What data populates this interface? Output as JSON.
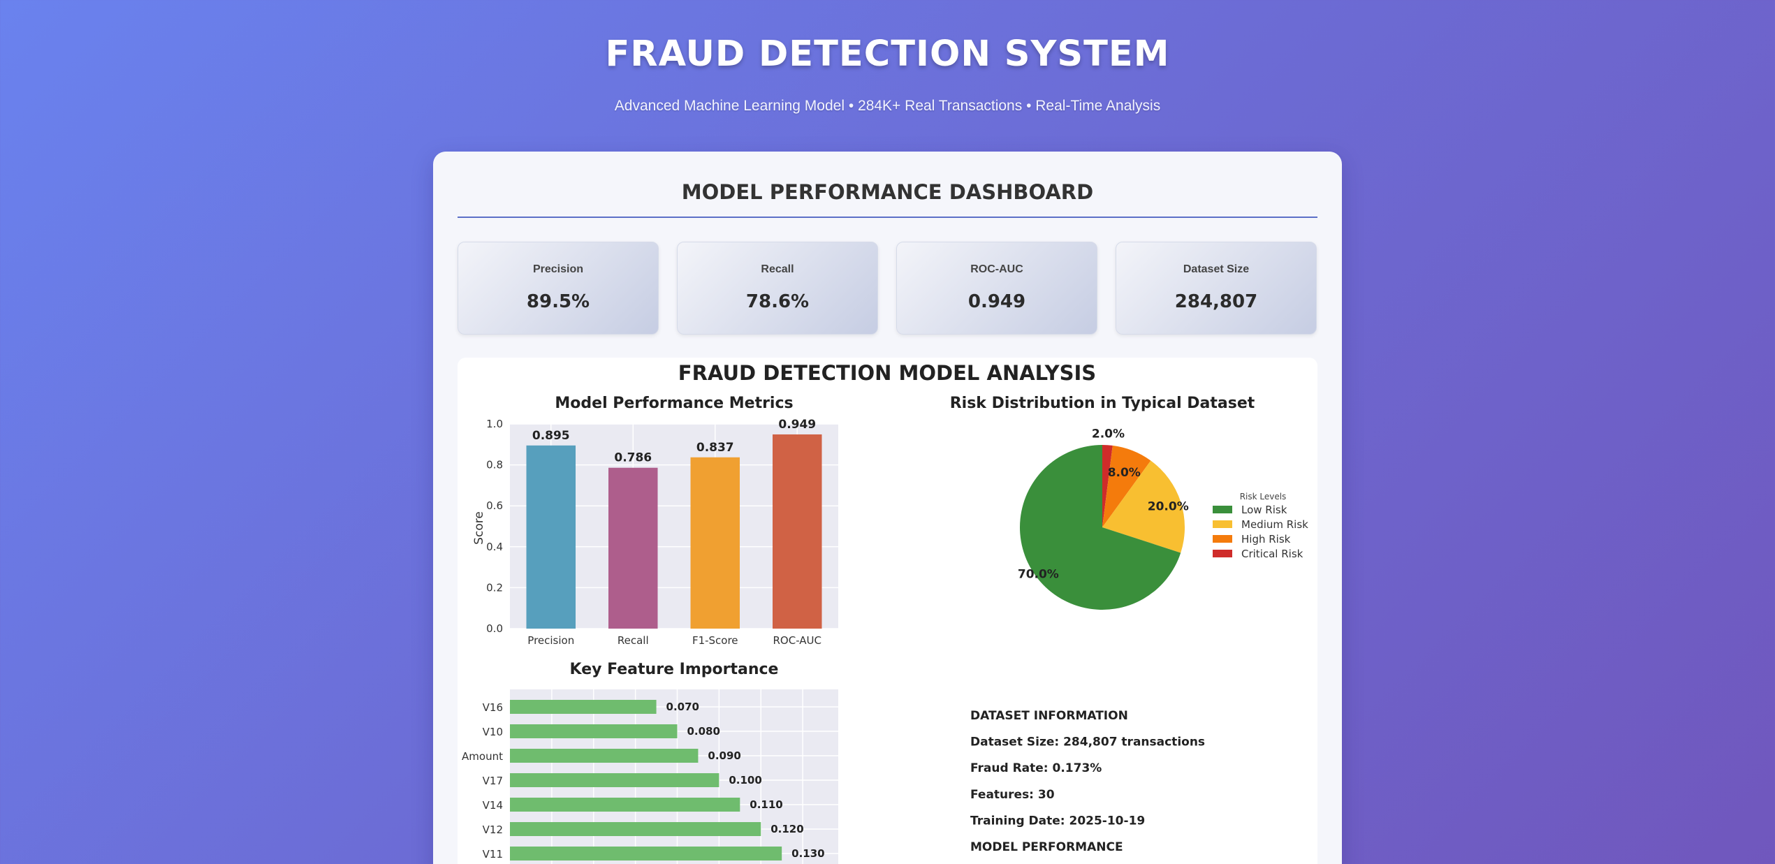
{
  "header": {
    "title": "FRAUD DETECTION SYSTEM",
    "subtitle": "Advanced Machine Learning Model • 284K+ Real Transactions • Real-Time Analysis"
  },
  "dashboard": {
    "title": "MODEL PERFORMANCE DASHBOARD",
    "cards": [
      {
        "label": "Precision",
        "value": "89.5%"
      },
      {
        "label": "Recall",
        "value": "78.6%"
      },
      {
        "label": "ROC-AUC",
        "value": "0.949"
      },
      {
        "label": "Dataset Size",
        "value": "284,807"
      }
    ]
  },
  "figure": {
    "title": "FRAUD DETECTION MODEL ANALYSIS",
    "info_lines": [
      "DATASET INFORMATION",
      "Dataset Size: 284,807 transactions",
      "Fraud Rate: 0.173%",
      "Features: 30",
      "Training Date: 2025-10-19",
      "MODEL PERFORMANCE"
    ]
  },
  "colors": {
    "precision": "#579fbd",
    "recall": "#ae5e8c",
    "f1": "#f0a031",
    "rocauc": "#d06245",
    "feature": "#6fbc6e",
    "low": "#3a8f3b",
    "medium": "#f8bf31",
    "high": "#f47b0c",
    "critical": "#cf2c2a"
  },
  "chart_data": [
    {
      "type": "bar",
      "title": "Model Performance Metrics",
      "ylabel": "Score",
      "xlabel": "",
      "categories": [
        "Precision",
        "Recall",
        "F1-Score",
        "ROC-AUC"
      ],
      "values": [
        0.895,
        0.786,
        0.837,
        0.949
      ],
      "value_labels": [
        "0.895",
        "0.786",
        "0.837",
        "0.949"
      ],
      "ylim": [
        0,
        1.0
      ],
      "yticks": [
        0.0,
        0.2,
        0.4,
        0.6,
        0.8,
        1.0
      ],
      "ytick_labels": [
        "0.0",
        "0.2",
        "0.4",
        "0.6",
        "0.8",
        "1.0"
      ],
      "grid": true
    },
    {
      "type": "pie",
      "title": "Risk Distribution in Typical Dataset",
      "labels": [
        "Low Risk",
        "Medium Risk",
        "High Risk",
        "Critical Risk"
      ],
      "values": [
        70.0,
        20.0,
        8.0,
        2.0
      ],
      "pct_labels": [
        "70.0%",
        "20.0%",
        "8.0%",
        "2.0%"
      ],
      "legend_title": "Risk Levels",
      "legend_position": "right"
    },
    {
      "type": "bar",
      "orientation": "horizontal",
      "title": "Key Feature Importance",
      "categories": [
        "V16",
        "V10",
        "Amount",
        "V17",
        "V14",
        "V12",
        "V11"
      ],
      "values": [
        0.07,
        0.08,
        0.09,
        0.1,
        0.11,
        0.12,
        0.13
      ],
      "value_labels": [
        "0.070",
        "0.080",
        "0.090",
        "0.100",
        "0.110",
        "0.120",
        "0.130"
      ],
      "grid": true
    }
  ]
}
